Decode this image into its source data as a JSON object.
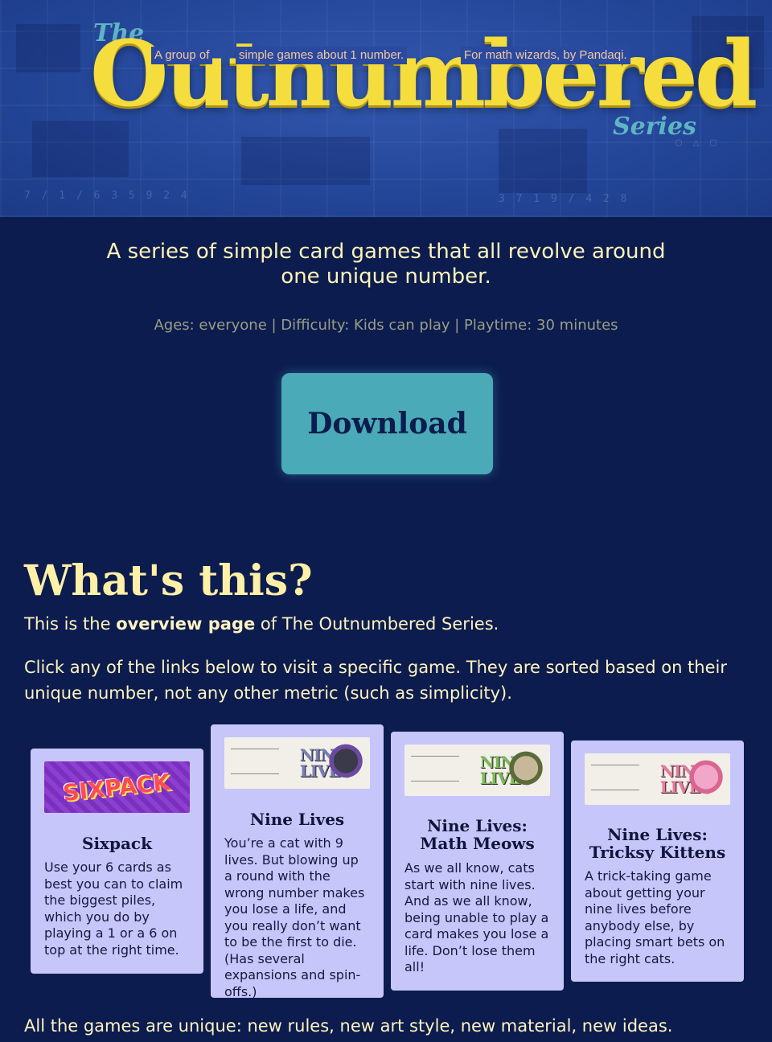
{
  "banner": {
    "logo_the": "The",
    "logo_main": "Outnumbered",
    "logo_series": "Series",
    "tag_1": "A group of",
    "tag_2": "simple games about 1 number.",
    "tag_3": "For math wizards, by Pandaqi."
  },
  "intro": {
    "subtitle": "A series of simple card games that all revolve around one unique number.",
    "meta": "Ages: everyone | Difficulty: Kids can play | Playtime: 30 minutes",
    "download_label": "Download"
  },
  "whats_this": {
    "title": "What's this?",
    "para1_prefix": "This is the ",
    "para1_bold": "overview page",
    "para1_suffix": " of The Outnumbered Series.",
    "para2": "Click any of the links below to visit a specific game. They are sorted based on their unique number, not any other metric (such as simplicity)."
  },
  "cards": [
    {
      "title": "Sixpack",
      "thumb_text": "SIXPACK",
      "description": "Use your 6 cards as best you can to claim the biggest piles, which you do by playing a 1 or a 6 on top at the right time."
    },
    {
      "title": "Nine Lives",
      "thumb_line1": "NINE",
      "thumb_line2": "LIVES",
      "description": "You’re a cat with 9 lives. But blowing up a round with the wrong number makes you lose a life, and you really don’t want to be the first to die. (Has several expansions and spin-offs.)"
    },
    {
      "title": "Nine Lives: Math Meows",
      "thumb_line1": "NINE",
      "thumb_line2": "LIVES",
      "description": "As we all know, cats start with nine lives. And as we all know, being unable to play a card makes you lose a life. Don’t lose them all!"
    },
    {
      "title": "Nine Lives: Tricksy Kittens",
      "thumb_line1": "NINE",
      "thumb_line2": "LIVES",
      "description": "A trick-taking game about getting your nine lives before anybody else, by placing smart bets on the right cats."
    }
  ],
  "closing": "All the games are unique: new rules, new art style, new material, new ideas.",
  "colors": {
    "background": "#0c1c4e",
    "accent_yellow": "#f4dd3c",
    "button_teal": "#4aaab8",
    "card_lavender": "#c6c6fb"
  }
}
